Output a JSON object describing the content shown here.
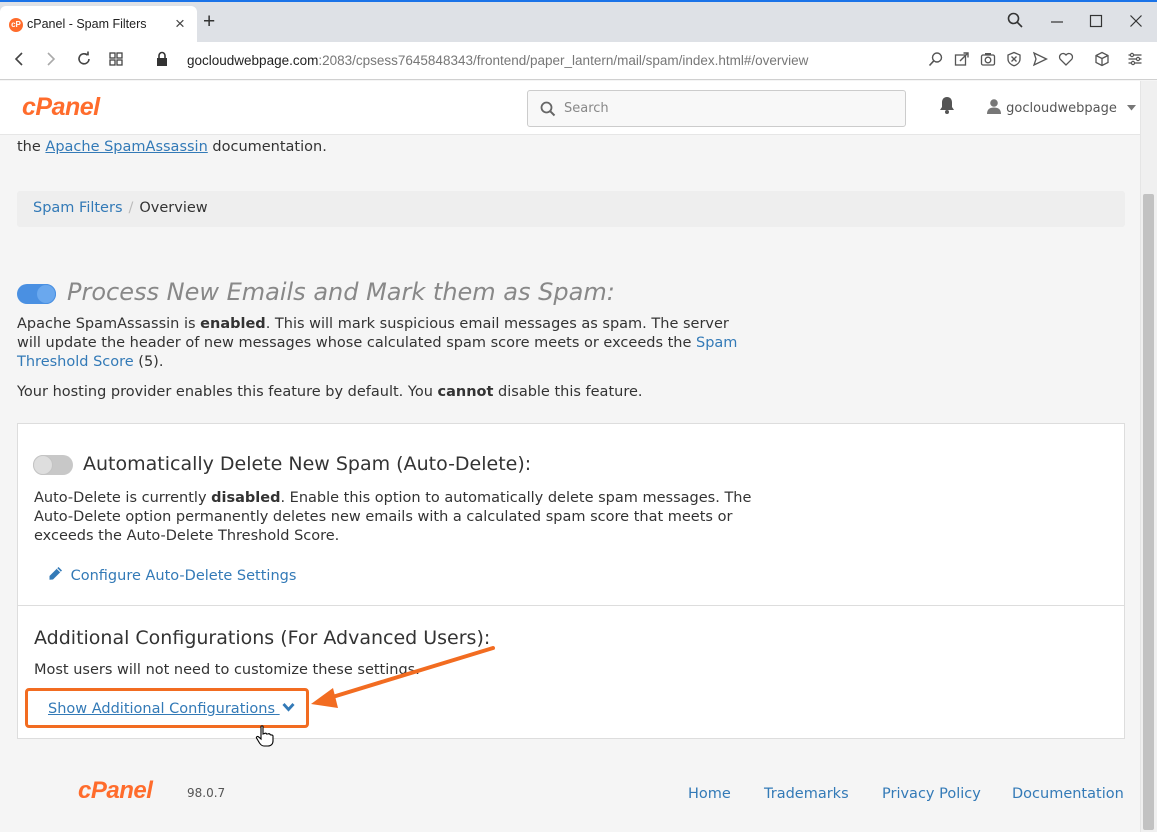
{
  "browser": {
    "tab_title": "cPanel - Spam Filters",
    "tab_favicon_text": "cP",
    "new_tab": "+",
    "url_host": "gocloudwebpage.com",
    "url_path": ":2083/cpsess7645848343/frontend/paper_lantern/mail/spam/index.html#/overview"
  },
  "header": {
    "logo_text": "cPanel",
    "search_placeholder": "Search",
    "username": "gocloudwebpage"
  },
  "intro": {
    "prefix": "the",
    "link": "Apache SpamAssassin",
    "suffix": "documentation."
  },
  "breadcrumb": {
    "parent": "Spam Filters",
    "separator": "/",
    "current": "Overview"
  },
  "process": {
    "toggle_state": "on",
    "title": "Process New Emails and Mark them as Spam:",
    "desc_1": "Apache SpamAssassin is",
    "desc_bold": "enabled",
    "desc_2": ". This will mark suspicious email messages as spam. The server will update the header of new messages whose calculated spam score meets or exceeds the",
    "desc_link": "Spam Threshold Score",
    "desc_3": "(5).",
    "note_1": "Your hosting provider enables this feature by default. You",
    "note_bold": "cannot",
    "note_2": "disable this feature."
  },
  "auto_delete": {
    "toggle_state": "off",
    "title": "Automatically Delete New Spam (Auto-Delete):",
    "desc_1": "Auto-Delete is currently",
    "desc_bold": "disabled",
    "desc_2": ". Enable this option to automatically delete spam messages. The Auto-Delete option permanently deletes new emails with a calculated spam score that meets or exceeds the Auto-Delete Threshold Score.",
    "configure_link": "Configure Auto-Delete Settings"
  },
  "additional": {
    "title": "Additional Configurations (For Advanced Users):",
    "desc": "Most users will not need to customize these settings.",
    "show_link": "Show Additional Configurations"
  },
  "footer": {
    "logo_text": "cPanel",
    "version": "98.0.7",
    "links": [
      "Home",
      "Trademarks",
      "Privacy Policy",
      "Documentation"
    ]
  },
  "colors": {
    "brand_orange": "#ff6c2c",
    "link_blue": "#337ab7",
    "annotation_orange": "#f26c21"
  }
}
